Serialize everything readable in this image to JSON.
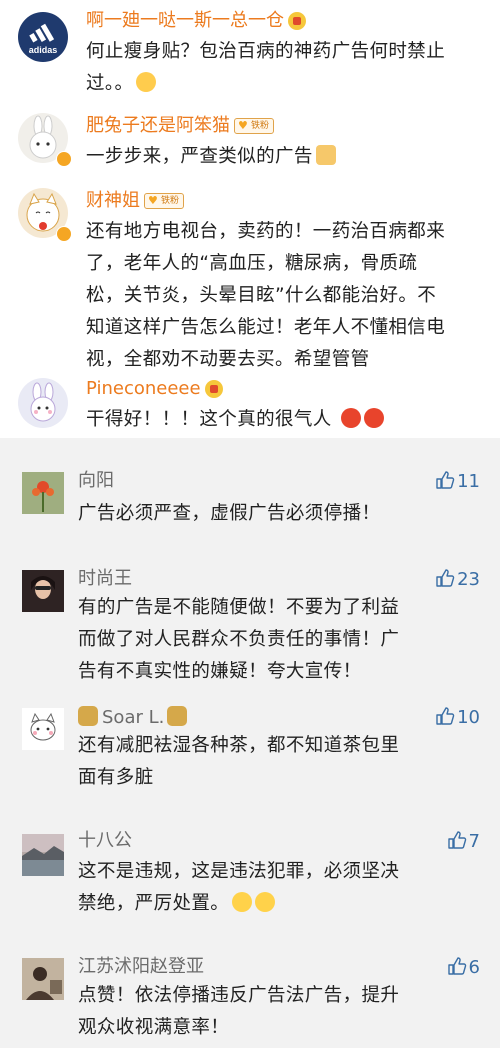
{
  "top_comments": [
    {
      "name": "啊一廸一哒一斯一总一仓",
      "badge": "",
      "text": [
        "何止瘦身贴？包治百病的神药广告何时禁止",
        "过。。"
      ]
    },
    {
      "name": "肥兔子还是阿笨猫",
      "badge": "铁粉",
      "text": [
        "一步步来，严查类似的广告"
      ]
    },
    {
      "name": "财神姐",
      "badge": "铁粉",
      "text": [
        "还有地方电视台，卖药的！一药治百病都来",
        "了，老年人的“高血压，糖尿病，骨质疏",
        "松，关节炎，头晕目眩”什么都能治好。不",
        "知道这样广告怎么能过！老年人不懂相信电",
        "视，全都劝不动要去买。希望管管"
      ]
    },
    {
      "name": "Pineconeeee",
      "badge": "",
      "text": [
        "干得好！！！这个真的很气人"
      ]
    }
  ],
  "replies": [
    {
      "name": "向阳",
      "likes": "11",
      "text": [
        "广告必须严查，虚假广告必须停播！"
      ]
    },
    {
      "name": "时尚王",
      "likes": "23",
      "text": [
        "有的广告是不能随便做！不要为了利益",
        "而做了对人民群众不负责任的事情！广",
        "告有不真实性的嫌疑！夸大宣传！"
      ]
    },
    {
      "name": "Soar L.",
      "likes": "10",
      "text": [
        "还有减肥袪湿各种茶，都不知道茶包里",
        "面有多脏"
      ]
    },
    {
      "name": "十八公",
      "likes": "7",
      "text": [
        "这不是违规，这是违法犯罪，必须坚决",
        "禁绝，严厉处置。"
      ]
    },
    {
      "name": "江苏沭阳赵登亚",
      "likes": "6",
      "text": [
        "点赞！依法停播违反广告法广告，提升",
        "观众收视满意率！"
      ]
    }
  ],
  "adidas_logo_text": "adidas",
  "colors": {
    "name_orange": "#ec7b1f",
    "like_blue": "#3a6ea5",
    "divider": "#f2f2f2"
  },
  "icons": [
    "thumbs-up-icon",
    "money-bag-icon",
    "crown-icon",
    "fan-badge-icon",
    "verified-badge-icon"
  ]
}
